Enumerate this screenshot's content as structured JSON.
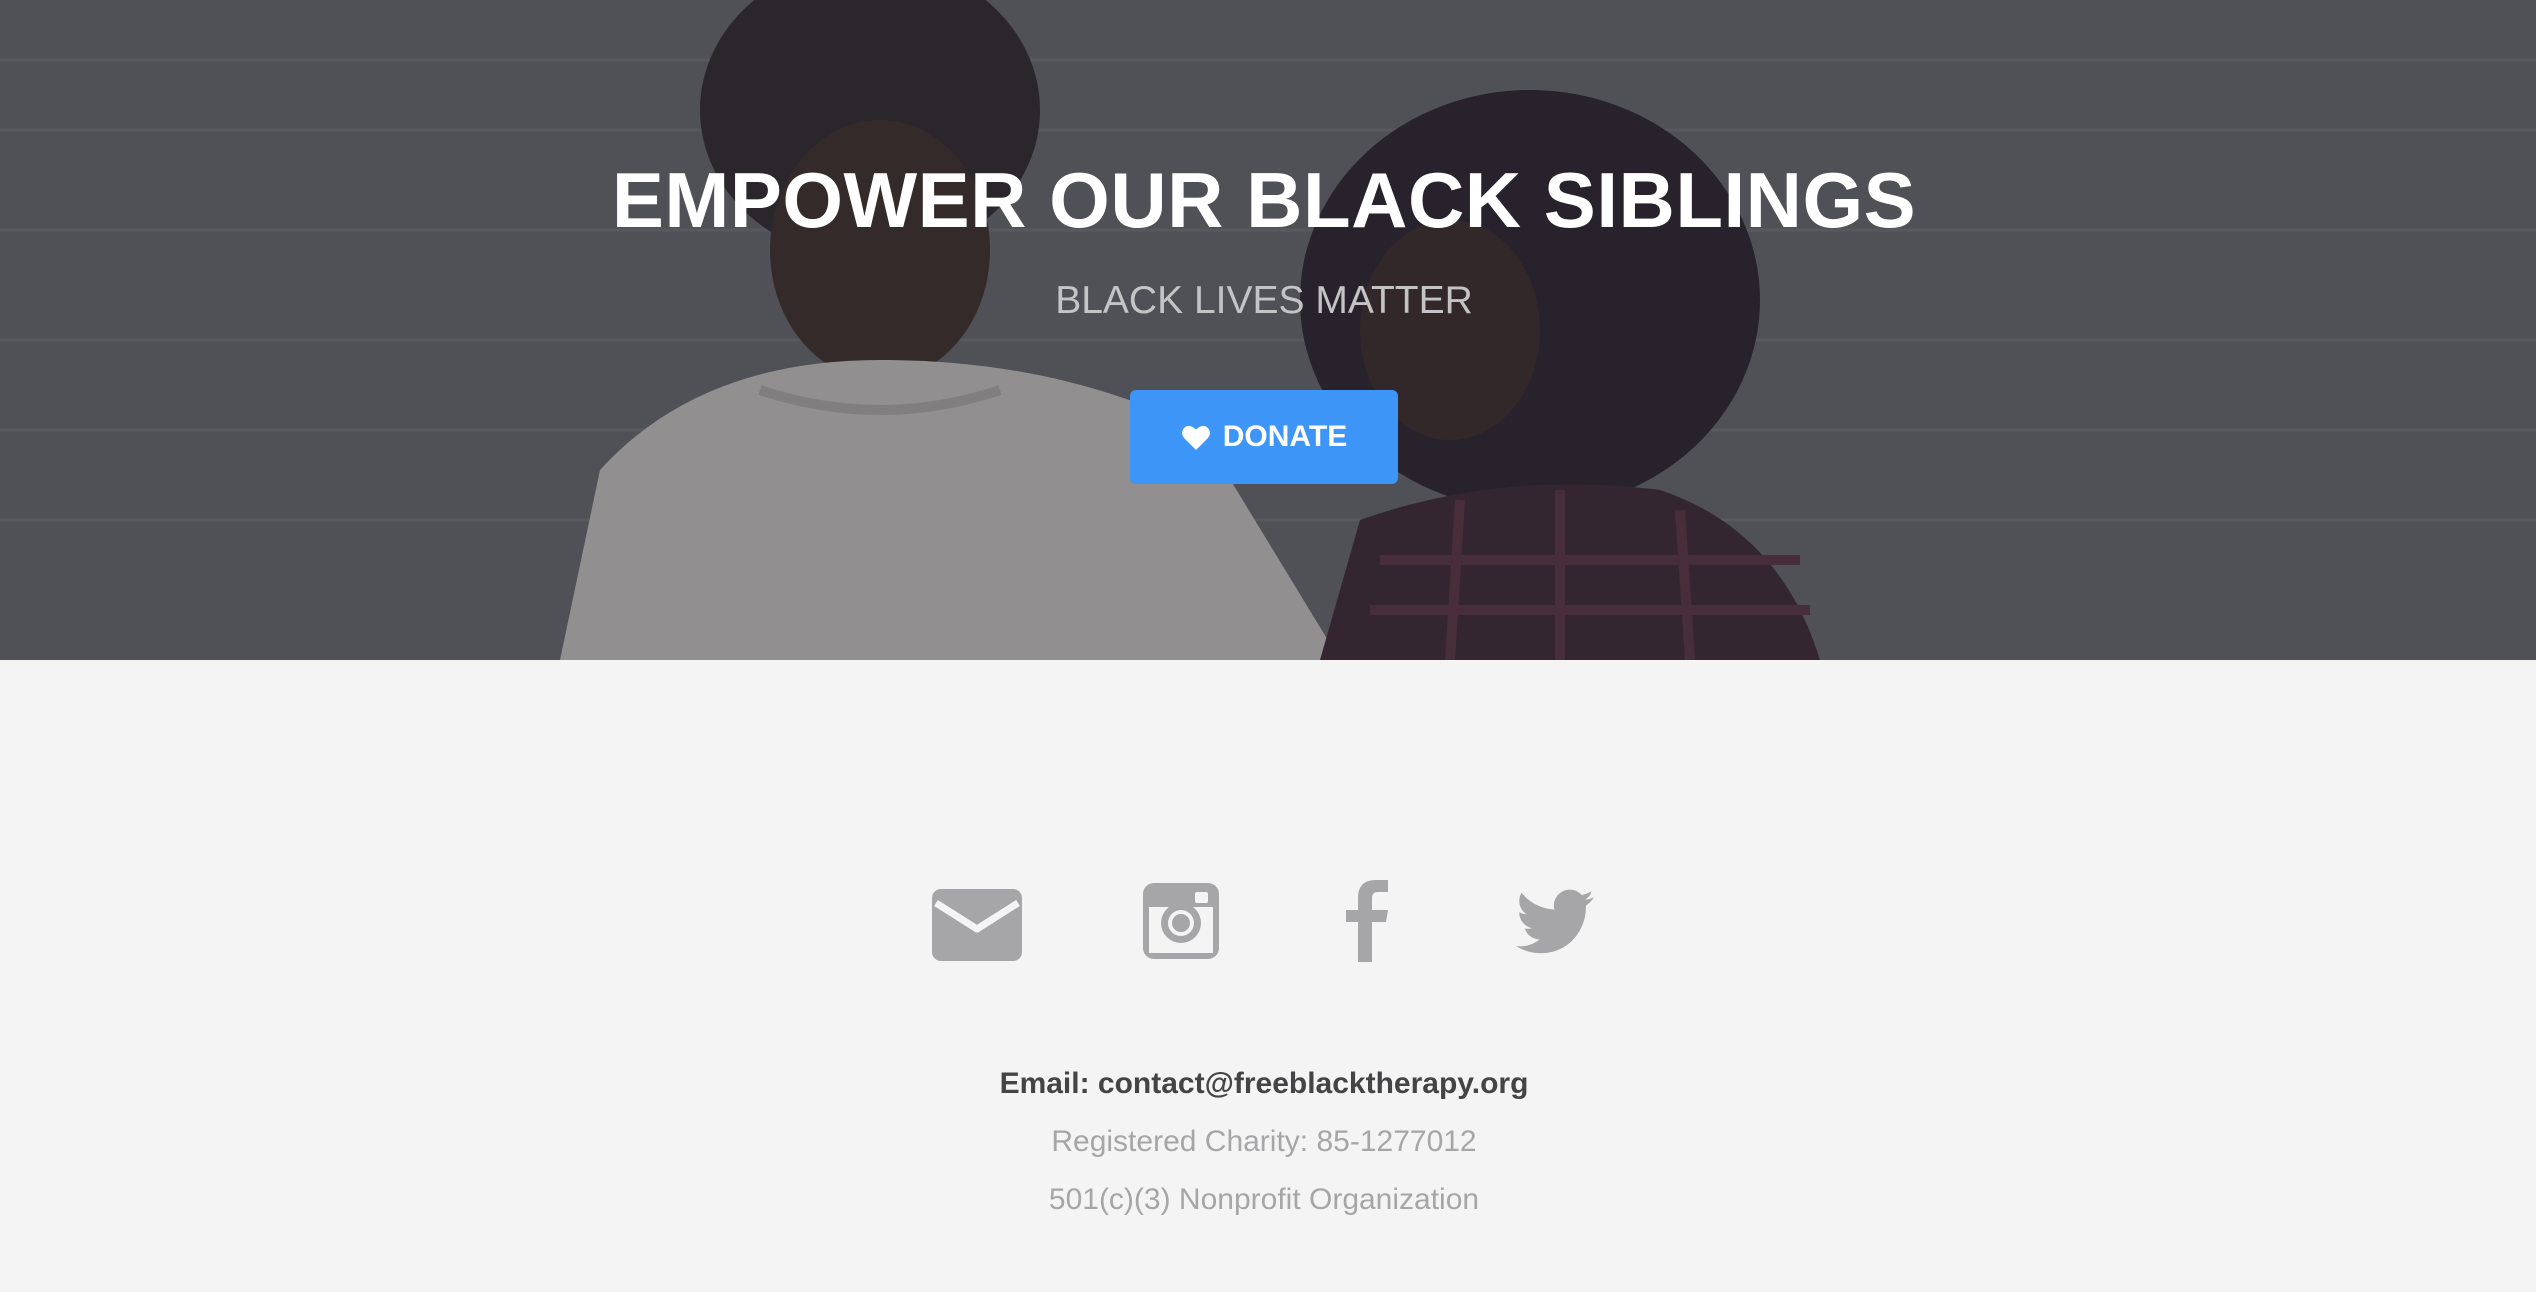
{
  "hero": {
    "title": "EMPOWER OUR BLACK SIBLINGS",
    "subtitle": "BLACK LIVES MATTER",
    "donate_label": "DONATE",
    "donate_icon": "heart-icon",
    "button_color": "#3d95f7"
  },
  "social": [
    {
      "name": "email",
      "icon": "envelope-icon"
    },
    {
      "name": "instagram",
      "icon": "instagram-icon"
    },
    {
      "name": "facebook",
      "icon": "facebook-icon"
    },
    {
      "name": "twitter",
      "icon": "twitter-icon"
    }
  ],
  "footer": {
    "email": "Email: contact@freeblacktherapy.org",
    "charity": "Registered Charity: 85-1277012",
    "nonprofit": "501(c)(3) Nonprofit Organization"
  }
}
